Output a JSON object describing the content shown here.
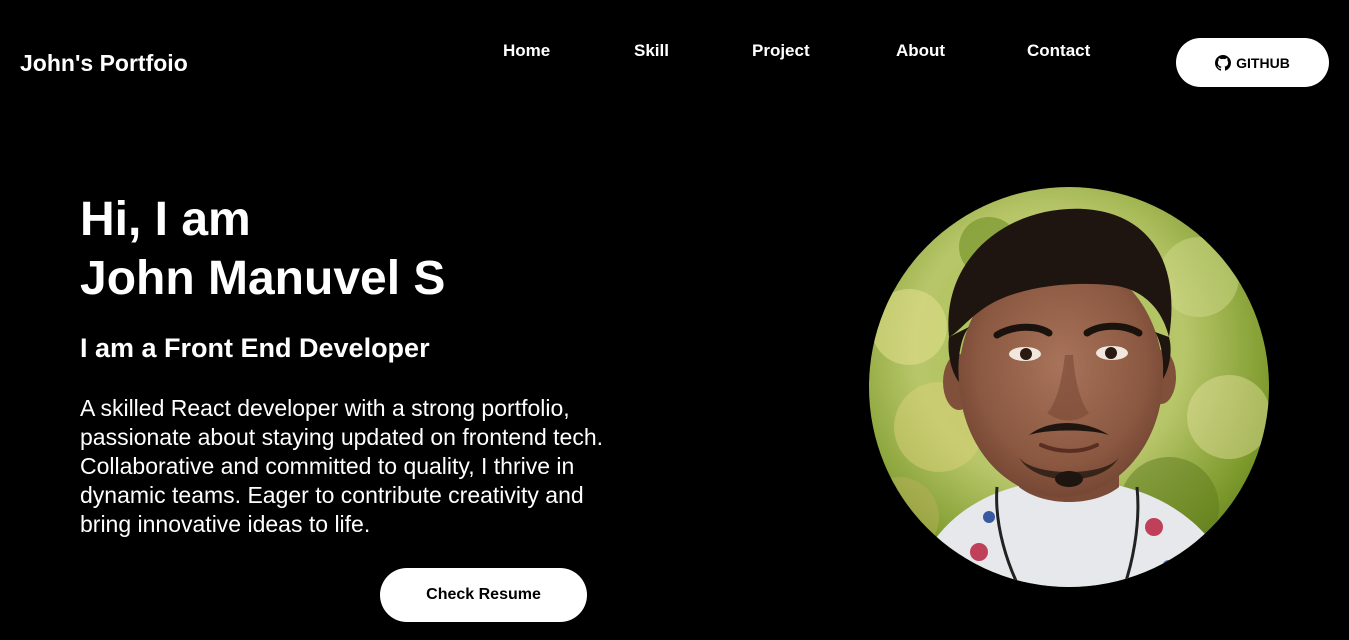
{
  "header": {
    "brand": "John's Portfoio",
    "nav": {
      "home": "Home",
      "skill": "Skill",
      "project": "Project",
      "about": "About",
      "contact": "Contact"
    },
    "github_label": "GITHUB",
    "github_icon": "github-icon"
  },
  "hero": {
    "greeting_line1": "Hi, I am",
    "greeting_line2": "John Manuvel S",
    "role": "I am a Front End Developer",
    "bio": [
      "A skilled React developer with a strong portfolio,",
      "passionate about staying updated on frontend tech.",
      "Collaborative and committed to quality, I thrive in",
      "dynamic teams. Eager to contribute creativity and",
      "bring innovative ideas to life."
    ],
    "resume_label": "Check Resume"
  },
  "colors": {
    "background": "#000000",
    "text": "#ffffff",
    "button_bg": "#ffffff",
    "button_text": "#000000"
  }
}
